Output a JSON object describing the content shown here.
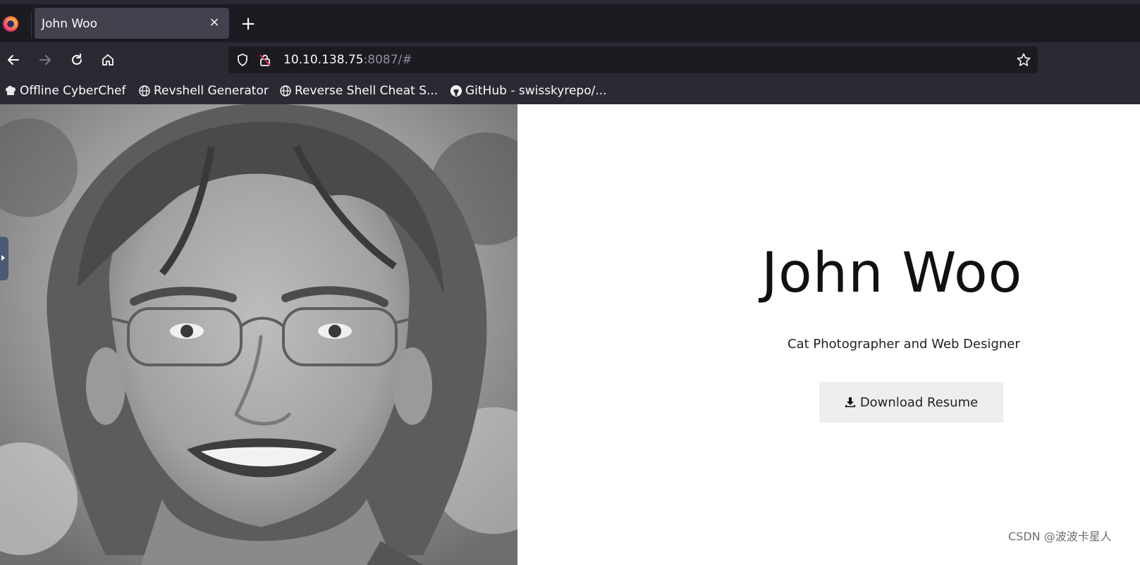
{
  "browser": {
    "tab": {
      "title": "John Woo",
      "close_glyph": "×"
    },
    "newtab_glyph": "+",
    "url": {
      "host": "10.10.138.75",
      "rest": ":8087/#"
    },
    "bookmarks": [
      {
        "label": "Offline CyberChef",
        "icon": "chef-hat-icon"
      },
      {
        "label": "Revshell Generator",
        "icon": "globe-icon"
      },
      {
        "label": "Reverse Shell Cheat S...",
        "icon": "globe-icon"
      },
      {
        "label": "GitHub - swisskyrepo/...",
        "icon": "github-icon"
      }
    ]
  },
  "page": {
    "name": "John Woo",
    "tagline": "Cat Photographer and Web Designer",
    "download_label": "Download Resume",
    "photo_subject": "portrait-photo"
  },
  "watermark": "CSDN @波波卡星人",
  "colors": {
    "chrome_dark": "#1c1b22",
    "chrome": "#2b2a33",
    "tab_active": "#42414d",
    "button_bg": "#eeeeee"
  }
}
